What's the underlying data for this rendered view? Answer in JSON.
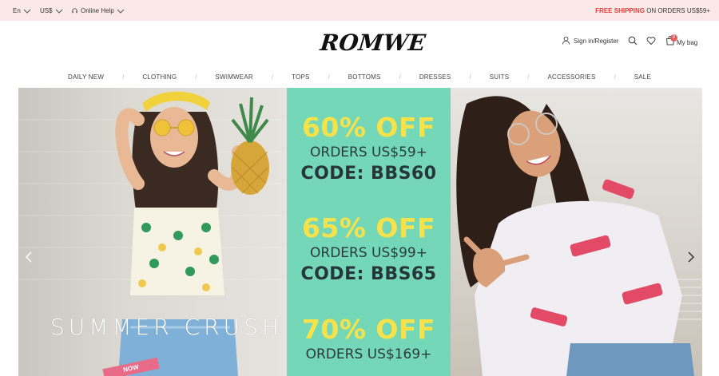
{
  "topbar": {
    "language": "En",
    "currency": "US$",
    "help": "Online Help",
    "promo_highlight": "FREE SHIPPING",
    "promo_rest": " ON ORDERS US$59+"
  },
  "header": {
    "logo_text": "ROMWE",
    "sign_in": "Sign in/Register",
    "bag_label": "My bag",
    "bag_count": "0"
  },
  "nav": {
    "items": [
      "DAILY NEW",
      "CLOTHING",
      "SWIMWEAR",
      "TOPS",
      "BOTTOMS",
      "DRESSES",
      "SUITS",
      "ACCESSORIES",
      "SALE"
    ]
  },
  "hero": {
    "caption": "SUMMER CRUSH",
    "badge": "NOW",
    "offers": [
      {
        "percent": "60% OFF",
        "orders": "ORDERS US$59+",
        "code": "CODE: BBS60"
      },
      {
        "percent": "65% OFF",
        "orders": "ORDERS US$99+",
        "code": "CODE: BBS65"
      },
      {
        "percent": "70% OFF",
        "orders": "ORDERS US$169+",
        "code": ""
      }
    ]
  },
  "colors": {
    "topbar_bg": "#fbe9e7",
    "promo_accent": "#e23b3b",
    "banner_mint": "#74d7b8",
    "offer_yellow": "#f6e24a",
    "badge_red": "#e45a5a"
  }
}
